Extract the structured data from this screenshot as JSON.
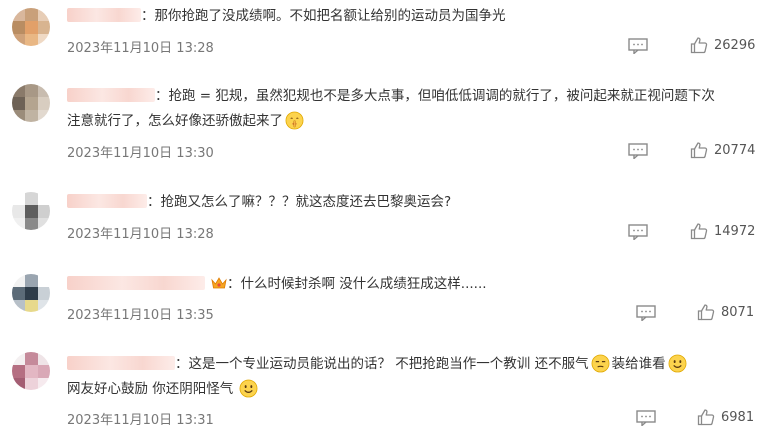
{
  "comments": [
    {
      "text": "：那你抢跑了没成绩啊。不如把名额让给别的运动员为国争光",
      "date": "2023年11月10日 13:28",
      "likes": "26296"
    },
    {
      "text_line1": "：抢跑 = 犯规，虽然犯规也不是多大点事，但咱低低调调的就行了，被问起来就正视问题下次",
      "text_line2": "注意就行了，怎么好像还骄傲起来了",
      "date": "2023年11月10日 13:30",
      "likes": "20774"
    },
    {
      "text": "：抢跑又怎么了嘛？？？就这态度还去巴黎奥运会?",
      "date": "2023年11月10日 13:28",
      "likes": "14972"
    },
    {
      "text": "：什么时候封杀啊 没什么成绩狂成这样......",
      "date": "2023年11月10日 13:35",
      "likes": "8071"
    },
    {
      "text_line1_a": "：这是一个专业运动员能说出的话？ 不把抢跑当作一个教训 还不服气",
      "text_line1_b": "装给谁看",
      "text_line2": "网友好心鼓励 你还阴阳怪气",
      "date": "2023年11月10日 13:31",
      "likes": "6981"
    }
  ],
  "icons": {
    "reply": "comment-reply-icon",
    "like": "thumbs-up-icon",
    "emoji_shush": "shushing-face-emoji",
    "emoji_unamused": "unamused-face-emoji",
    "emoji_smile": "smiling-face-emoji",
    "crown": "crown-badge-icon"
  },
  "colors": {
    "text": "#333333",
    "meta": "#777777",
    "icon": "#8a8a8a"
  }
}
